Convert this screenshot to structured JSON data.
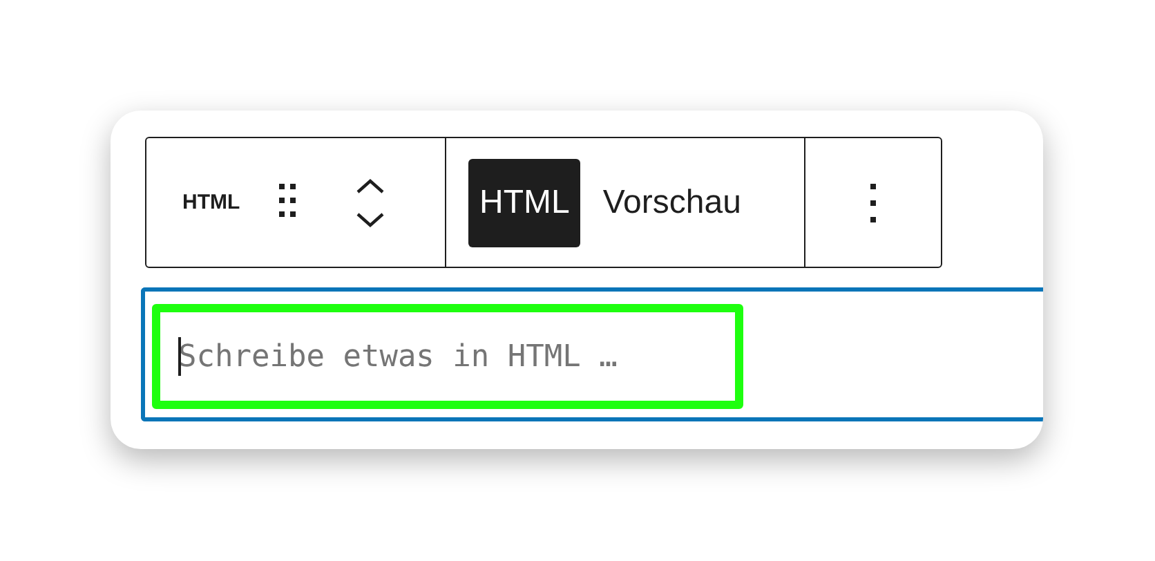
{
  "toolbar": {
    "block_label": "HTML",
    "tabs": [
      {
        "label": "HTML",
        "selected": true
      },
      {
        "label": "Vorschau",
        "selected": false
      }
    ]
  },
  "editor": {
    "placeholder": "Schreibe etwas in HTML …",
    "focused": true
  }
}
